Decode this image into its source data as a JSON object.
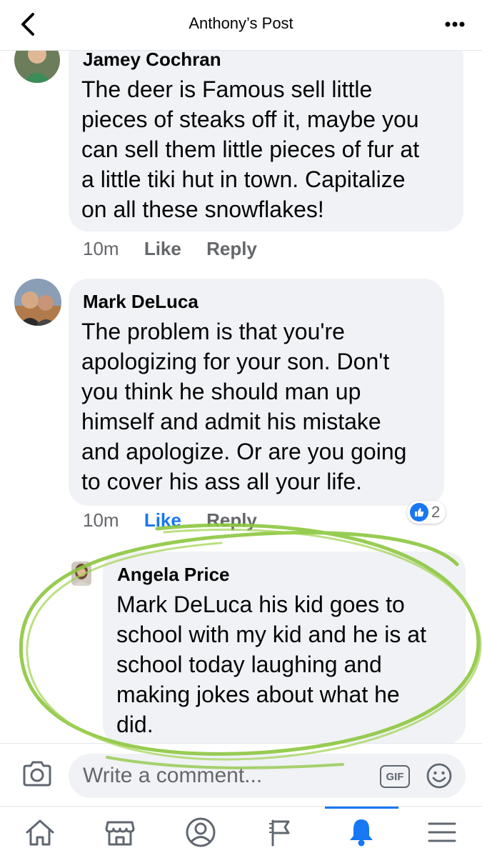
{
  "header": {
    "title": "Anthony’s Post",
    "back_icon": "chevron-left-icon",
    "more_icon": "more-dots-icon"
  },
  "comments": [
    {
      "author": "Jamey Cochran",
      "text": "The deer is Famous sell little\npieces of steaks off it, maybe you\ncan sell them little pieces of fur at\na little tiki hut in town. Capitalize\non all these snowflakes!",
      "time": "10m",
      "like_label": "Like",
      "reply_label": "Reply"
    },
    {
      "author": "Mark DeLuca",
      "text": "The problem is that you're\napologizing for your son. Don't\nyou think he should man up\nhimself and admit his mistake\nand apologize. Or are you going\nto cover his ass all your life.",
      "time": "10m",
      "like_label": "Like",
      "reply_label": "Reply",
      "reaction_count": "2"
    },
    {
      "author": "Angela Price",
      "text": "Mark DeLuca his kid goes to\nschool with my kid and he is at\nschool today laughing and\nmaking jokes about what he\ndid."
    }
  ],
  "composer": {
    "placeholder": "Write a comment...",
    "gif_label": "GIF"
  },
  "tabs": [
    {
      "icon": "home-icon"
    },
    {
      "icon": "marketplace-icon"
    },
    {
      "icon": "profile-icon"
    },
    {
      "icon": "flag-icon"
    },
    {
      "icon": "notifications-bell-icon",
      "active": true
    },
    {
      "icon": "menu-icon"
    }
  ],
  "colors": {
    "accent": "#1877f2",
    "bubble": "#f0f2f5",
    "secondary_text": "#65676b",
    "annotation": "#8cc63f"
  }
}
